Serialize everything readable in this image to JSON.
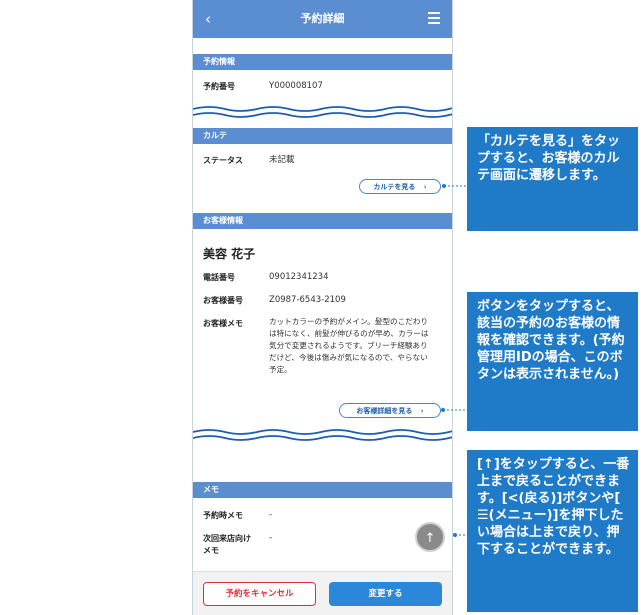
{
  "header": {
    "title": "予約詳細",
    "back_glyph": "‹"
  },
  "reservation_section": {
    "title": "予約情報",
    "number_label": "予約番号",
    "number_value": "Y000008107"
  },
  "karte_section": {
    "title": "カルテ",
    "status_label": "ステータス",
    "status_value": "未記載",
    "view_button": "カルテを見る"
  },
  "customer_section": {
    "title": "お客様情報",
    "name": "美容 花子",
    "phone_label": "電話番号",
    "phone_value": "09012341234",
    "customer_no_label": "お客様番号",
    "customer_no_value": "Z0987-6543-2109",
    "memo_label": "お客様メモ",
    "memo_value": "カットカラーの予約がメイン。髪型のこだわりは特になく、前髪が伸びるのが早め、カラーは気分で変更されるようです。ブリーチ経験ありだけど、今後は傷みが気になるので、やらない予定。",
    "detail_button": "お客様詳細を見る"
  },
  "memo_section": {
    "title": "メモ",
    "reserve_memo_label": "予約時メモ",
    "reserve_memo_value": "-",
    "next_visit_label_1": "次回来店向け",
    "next_visit_label_2": "メモ",
    "next_visit_value": "-"
  },
  "scroll_top_glyph": "↑",
  "footer": {
    "cancel_label": "予約をキャンセル",
    "change_label": "変更する"
  },
  "callouts": {
    "karte": "「カルテを見る」をタップすると、お客様のカルテ画面に遷移します。",
    "customer": "ボタンをタップすると、該当の予約のお客様の情報を確認できます。(予約管理用IDの場合、このボタンは表示されません。)",
    "scroll_top": "[↑]をタップすると、一番上まで戻ることができます。[<(戻る)]ボタンや[ ☰(メニュー)]を押下したい場合は上まで戻り、押下することができます。"
  },
  "colors": {
    "header": "#5b8ed0",
    "callout": "#1f7ac7",
    "cancel": "#e0303a",
    "primary": "#2b87d9"
  },
  "icons": {
    "back": "chevron-left-icon",
    "menu": "menu-icon",
    "scroll_top": "arrow-up-icon",
    "pill_arrow": "chevron-right-icon"
  }
}
